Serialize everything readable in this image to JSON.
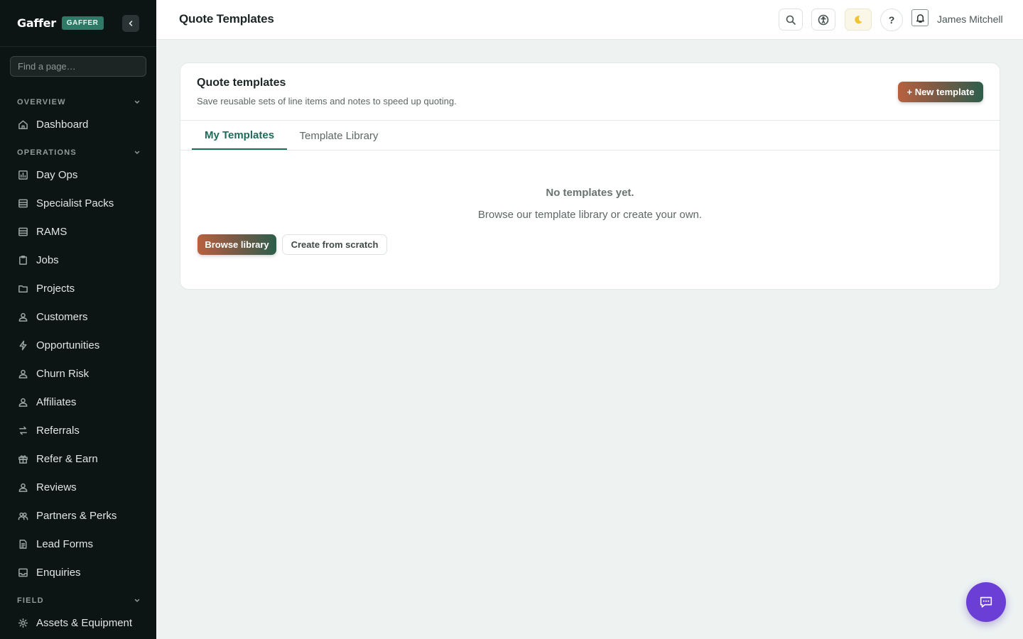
{
  "app": {
    "name": "Gaffer",
    "badge": "GAFFER"
  },
  "sidebar": {
    "search_placeholder": "Find a page…",
    "sections": [
      {
        "label": "OVERVIEW"
      },
      {
        "label": "OPERATIONS"
      },
      {
        "label": "FIELD"
      }
    ],
    "items": [
      {
        "label": "Dashboard",
        "icon": "home-icon"
      },
      {
        "label": "Day Ops",
        "icon": "chart-icon"
      },
      {
        "label": "Specialist Packs",
        "icon": "table-icon"
      },
      {
        "label": "RAMS",
        "icon": "table-icon"
      },
      {
        "label": "Jobs",
        "icon": "clipboard-icon"
      },
      {
        "label": "Projects",
        "icon": "folder-icon"
      },
      {
        "label": "Customers",
        "icon": "user-icon"
      },
      {
        "label": "Opportunities",
        "icon": "bolt-icon"
      },
      {
        "label": "Churn Risk",
        "icon": "user-icon"
      },
      {
        "label": "Affiliates",
        "icon": "user-icon"
      },
      {
        "label": "Referrals",
        "icon": "swap-icon"
      },
      {
        "label": "Refer & Earn",
        "icon": "gift-icon"
      },
      {
        "label": "Reviews",
        "icon": "user-icon"
      },
      {
        "label": "Partners & Perks",
        "icon": "users-icon"
      },
      {
        "label": "Lead Forms",
        "icon": "document-icon"
      },
      {
        "label": "Enquiries",
        "icon": "inbox-icon"
      },
      {
        "label": "Assets & Equipment",
        "icon": "gear-icon"
      }
    ]
  },
  "header": {
    "title": "Quote Templates",
    "help_label": "?",
    "user_name": "James Mitchell"
  },
  "card": {
    "title": "Quote templates",
    "subtitle": "Save reusable sets of line items and notes to speed up quoting.",
    "new_button": "+ New template",
    "tabs": [
      {
        "label": "My Templates",
        "active": true
      },
      {
        "label": "Template Library",
        "active": false
      }
    ],
    "empty_title": "No templates yet.",
    "empty_subtitle": "Browse our template library or create your own.",
    "browse_button": "Browse library",
    "scratch_button": "Create from scratch"
  },
  "colors": {
    "sidebar_bg": "#0c1414",
    "accent_green": "#1f6b59",
    "gradient_start": "#b8613f",
    "gradient_end": "#2d5e4c",
    "chat_fab": "#6b3fd6"
  }
}
